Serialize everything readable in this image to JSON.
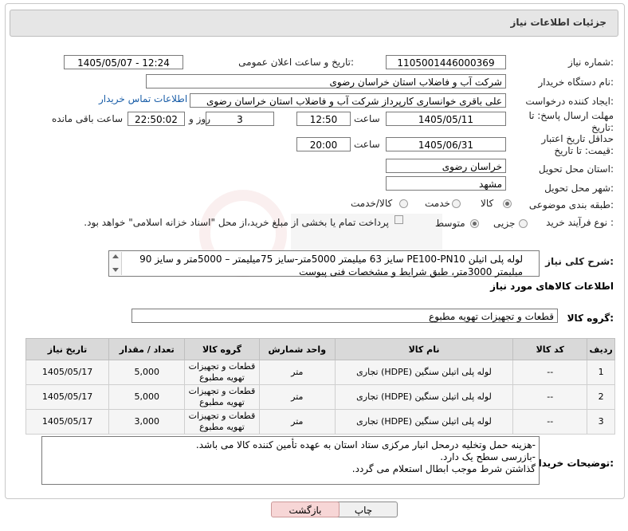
{
  "page_title": "جزئیات اطلاعات نیاز",
  "fields": {
    "need_number_label": "شماره نیاز:",
    "need_number": "1105001446000369",
    "announce_label": "تاریخ و ساعت اعلان عمومی:",
    "announce_value": "1405/05/07 - 12:24",
    "buyer_org_label": "نام دستگاه خریدار:",
    "buyer_org": "شرکت آب و فاضلاب استان خراسان رضوی",
    "creator_label": "ایجاد کننده درخواست:",
    "creator": "علی باقری خوانساری کارپرداز شرکت آب و فاضلاب استان خراسان رضوی",
    "contact_link": "اطلاعات تماس خریدار",
    "deadline_label": "مهلت ارسال پاسخ: تا تاریخ:",
    "deadline_date": "1405/05/11",
    "time_label": "ساعت",
    "deadline_time": "12:50",
    "days_value": "3",
    "days_label": "روز و",
    "remaining_time": "22:50:02",
    "remaining_label": "ساعت باقی مانده",
    "validity_label": "حداقل تاریخ اعتبار قیمت: تا تاریخ:",
    "validity_date": "1405/06/31",
    "validity_time": "20:00",
    "province_label": "استان محل تحویل:",
    "province": "خراسان رضوی",
    "city_label": "شهر محل تحویل:",
    "city": "مشهد",
    "category_label": "طبقه بندی موضوعی:",
    "category_options": [
      "کالا",
      "خدمت",
      "کالا/خدمت"
    ],
    "purchase_type_label": "نوع فرآیند خرید :",
    "purchase_options": [
      "جزیی",
      "متوسط"
    ],
    "payment_note": "پرداخت تمام یا بخشی از مبلغ خرید،از محل \"اسناد خزانه اسلامی\" خواهد بود."
  },
  "description": {
    "label": "شرح کلی نیاز:",
    "text": "لوله پلی اتیلن PE100-PN10 سایز 63 میلیمتر 5000متر-سایز 75میلیمتر – 5000متر و سایز 90 میلیمتر 3000متر، طبق شرایط و مشخصات فنی پیوست"
  },
  "goods_section": {
    "title": "اطلاعات کالاهای مورد نیاز",
    "group_label": "گروه کالا:",
    "group_value": "قطعات و تجهیزات تهویه مطبوع"
  },
  "table": {
    "headers": [
      "ردیف",
      "کد کالا",
      "نام کالا",
      "واحد شمارش",
      "گروه کالا",
      "تعداد / مقدار",
      "تاریخ نیاز"
    ],
    "rows": [
      [
        "1",
        "--",
        "لوله پلی اتیلن سنگین (HDPE) تجاری",
        "متر",
        "قطعات و تجهیزات تهویه مطبوع",
        "5,000",
        "1405/05/17"
      ],
      [
        "2",
        "--",
        "لوله پلی اتیلن سنگین (HDPE) تجاری",
        "متر",
        "قطعات و تجهیزات تهویه مطبوع",
        "5,000",
        "1405/05/17"
      ],
      [
        "3",
        "--",
        "لوله پلی اتیلن سنگین (HDPE) تجاری",
        "متر",
        "قطعات و تجهیزات تهویه مطبوع",
        "3,000",
        "1405/05/17"
      ]
    ]
  },
  "buyer_notes": {
    "label": "توضیحات خریدار:",
    "lines": [
      "-هزینه حمل وتخلیه درمحل انبار مرکزی ستاد استان به عهده تأمین کننده کالا می باشد.",
      "-بازرسی سطح یک دارد.",
      "گذاشتن شرط موجب ابطال استعلام می گردد."
    ]
  },
  "buttons": {
    "print": "چاپ",
    "back": "بازگشت"
  },
  "colors": {
    "back_button": "#f7d6d6",
    "link": "#1a5ea8",
    "header_bg": "#d9d9d9"
  }
}
